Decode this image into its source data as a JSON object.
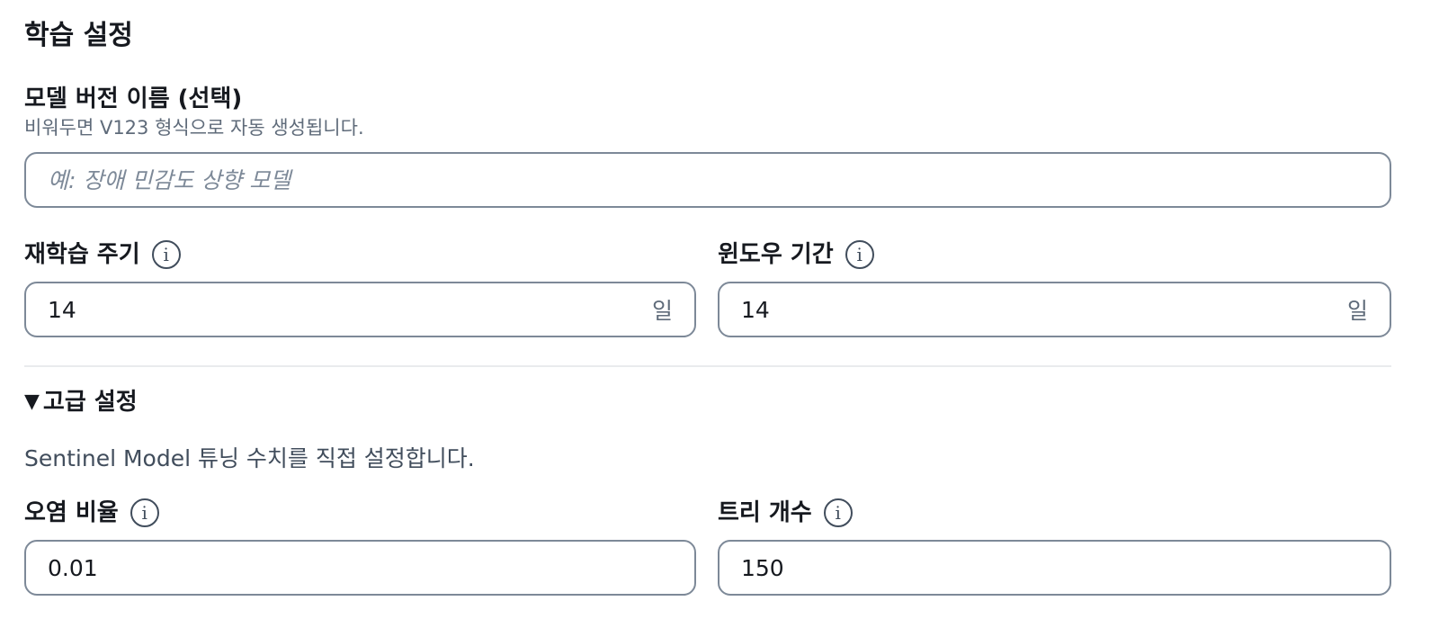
{
  "section": {
    "title": "학습 설정"
  },
  "model_version": {
    "label": "모델 버전 이름 (선택)",
    "description": "비워두면 V123 형식으로 자동 생성됩니다.",
    "placeholder": "예: 장애 민감도 상향 모델",
    "value": ""
  },
  "retrain_cycle": {
    "label": "재학습 주기",
    "info_icon": "info-icon",
    "value": "14",
    "unit": "일"
  },
  "window_period": {
    "label": "윈도우 기간",
    "info_icon": "info-icon",
    "value": "14",
    "unit": "일"
  },
  "advanced": {
    "label": "고급 설정",
    "expanded": true,
    "caret_icon": "caret-down-icon",
    "description": "Sentinel Model 튜닝 수치를 직접 설정합니다."
  },
  "contamination": {
    "label": "오염 비율",
    "info_icon": "info-icon",
    "value": "0.01"
  },
  "tree_count": {
    "label": "트리 개수",
    "info_icon": "info-icon",
    "value": "150"
  },
  "colors": {
    "border": "#7d8998",
    "text": "#16191f",
    "muted": "#5f6b7a",
    "divider": "#e9ebed"
  }
}
